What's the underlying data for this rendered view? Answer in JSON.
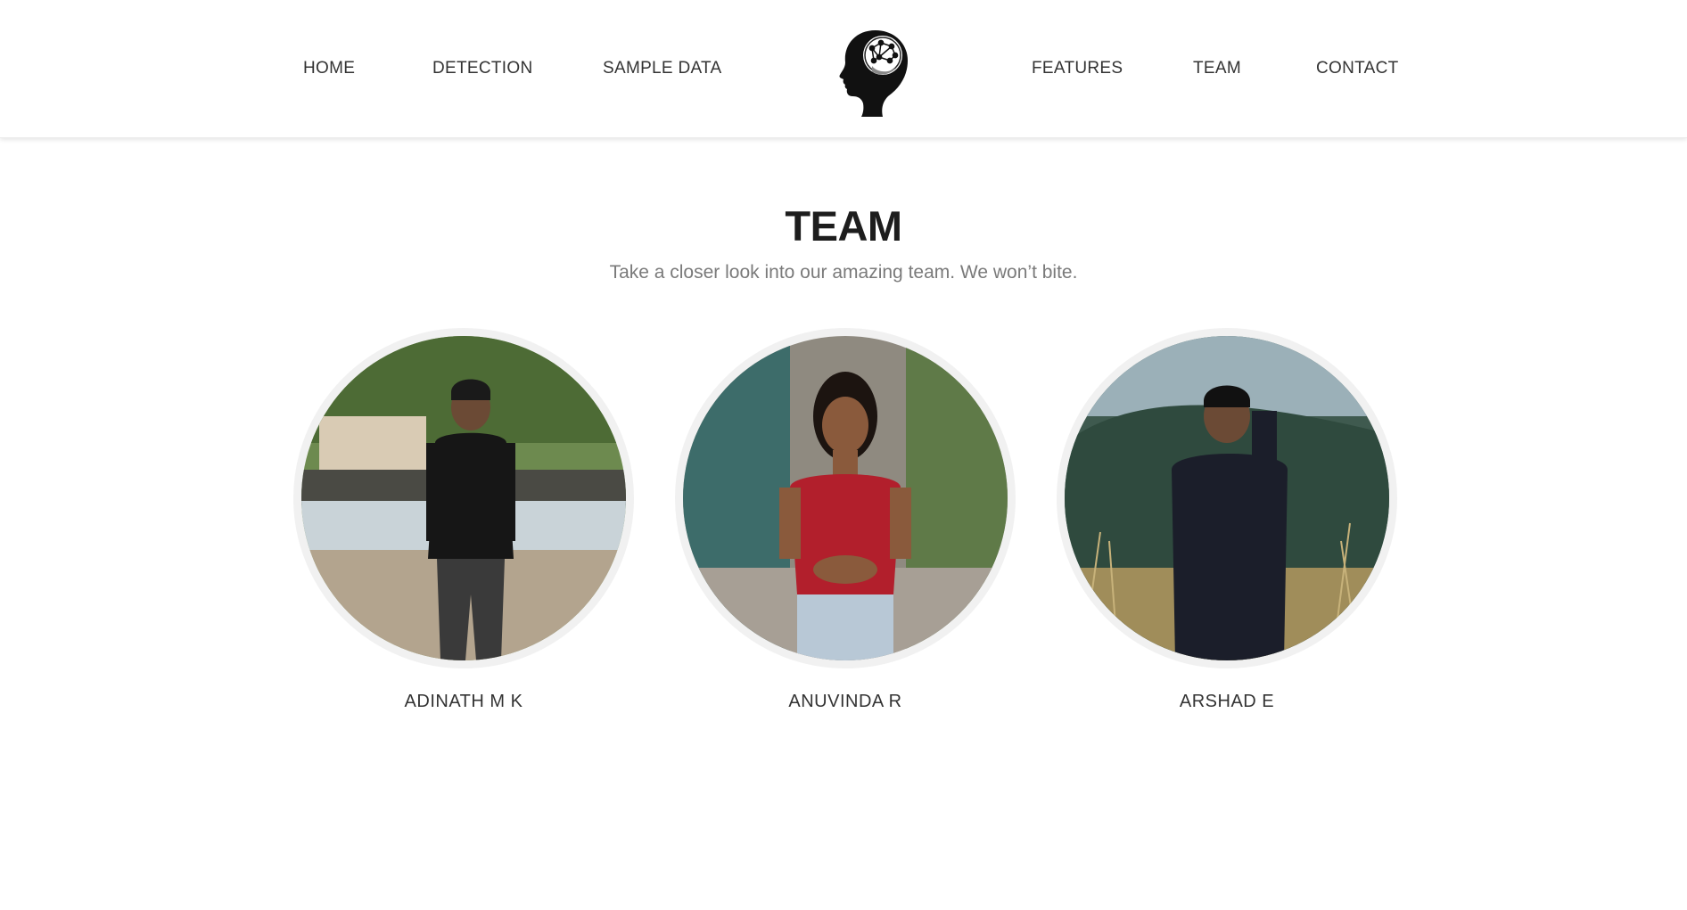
{
  "nav": {
    "left_items": [
      {
        "label": "HOME"
      },
      {
        "label": "DETECTION"
      },
      {
        "label": "SAMPLE DATA"
      }
    ],
    "right_items": [
      {
        "label": "FEATURES"
      },
      {
        "label": "TEAM"
      },
      {
        "label": "CONTACT"
      }
    ],
    "logo_icon": "brain-head-logo-icon"
  },
  "team": {
    "title": "TEAM",
    "subtitle": "Take a closer look into our amazing team. We won’t bite.",
    "members": [
      {
        "name": "ADINATH M K",
        "photo_icon": "avatar-photo"
      },
      {
        "name": "ANUVINDA R",
        "photo_icon": "avatar-photo"
      },
      {
        "name": "ARSHAD E",
        "photo_icon": "avatar-photo"
      }
    ]
  },
  "colors": {
    "nav_text": "#333333",
    "title": "#1d1d1d",
    "subtitle": "#7a7a7a",
    "photo_ring": "#f1f1f1"
  }
}
